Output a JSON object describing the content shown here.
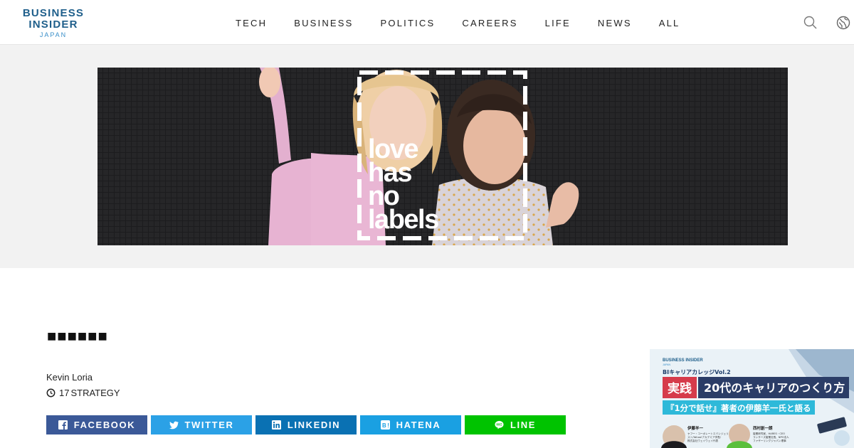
{
  "header": {
    "logo": {
      "line1": "BUSINESS",
      "line2": "INSIDER",
      "line3": "JAPAN"
    },
    "nav": [
      "TECH",
      "BUSINESS",
      "POLITICS",
      "CAREERS",
      "LIFE",
      "NEWS",
      "ALL"
    ],
    "icons": [
      "search-icon",
      "globe-icon"
    ]
  },
  "hero": {
    "caption_lines": [
      "love",
      "has",
      "no",
      "labels"
    ]
  },
  "article": {
    "title": "■■■■■■",
    "author": "Kevin Loria",
    "date": "17",
    "category": "STRATEGY"
  },
  "share": {
    "facebook": "FACEBOOK",
    "twitter": "TWITTER",
    "linkedin": "LINKEDIN",
    "hatena": "HATENA",
    "line": "LINE"
  },
  "ad": {
    "brand": "BUSINESS INSIDER",
    "brand_sub": "JAPAN",
    "series": "BIキャリアカレッジVol.2",
    "tag": "実践",
    "headline": "20代のキャリアのつくり方",
    "subhead": "『1分で話せ』著者の伊藤羊一氏と語る",
    "speaker1": "伊藤羊一",
    "speaker1_desc": [
      "ヤフー・コーポレートエバンジェリ",
      "スト/Yahoo!アカデミア学長/",
      "株式会社ウェイウェイ代表"
    ],
    "speaker2": "西村創一朗",
    "speaker2_desc": [
      "複業研究家、HARES・CEO",
      "ランサーズ複業社長、NPO法人",
      "ファザーリングジャパン理事"
    ]
  },
  "colors": {
    "logo": "#1f5f8b",
    "facebook": "#3b5998",
    "twitter": "#2ba1e6",
    "linkedin": "#0a71b3",
    "hatena": "#1aa0e2",
    "line": "#00c300"
  }
}
